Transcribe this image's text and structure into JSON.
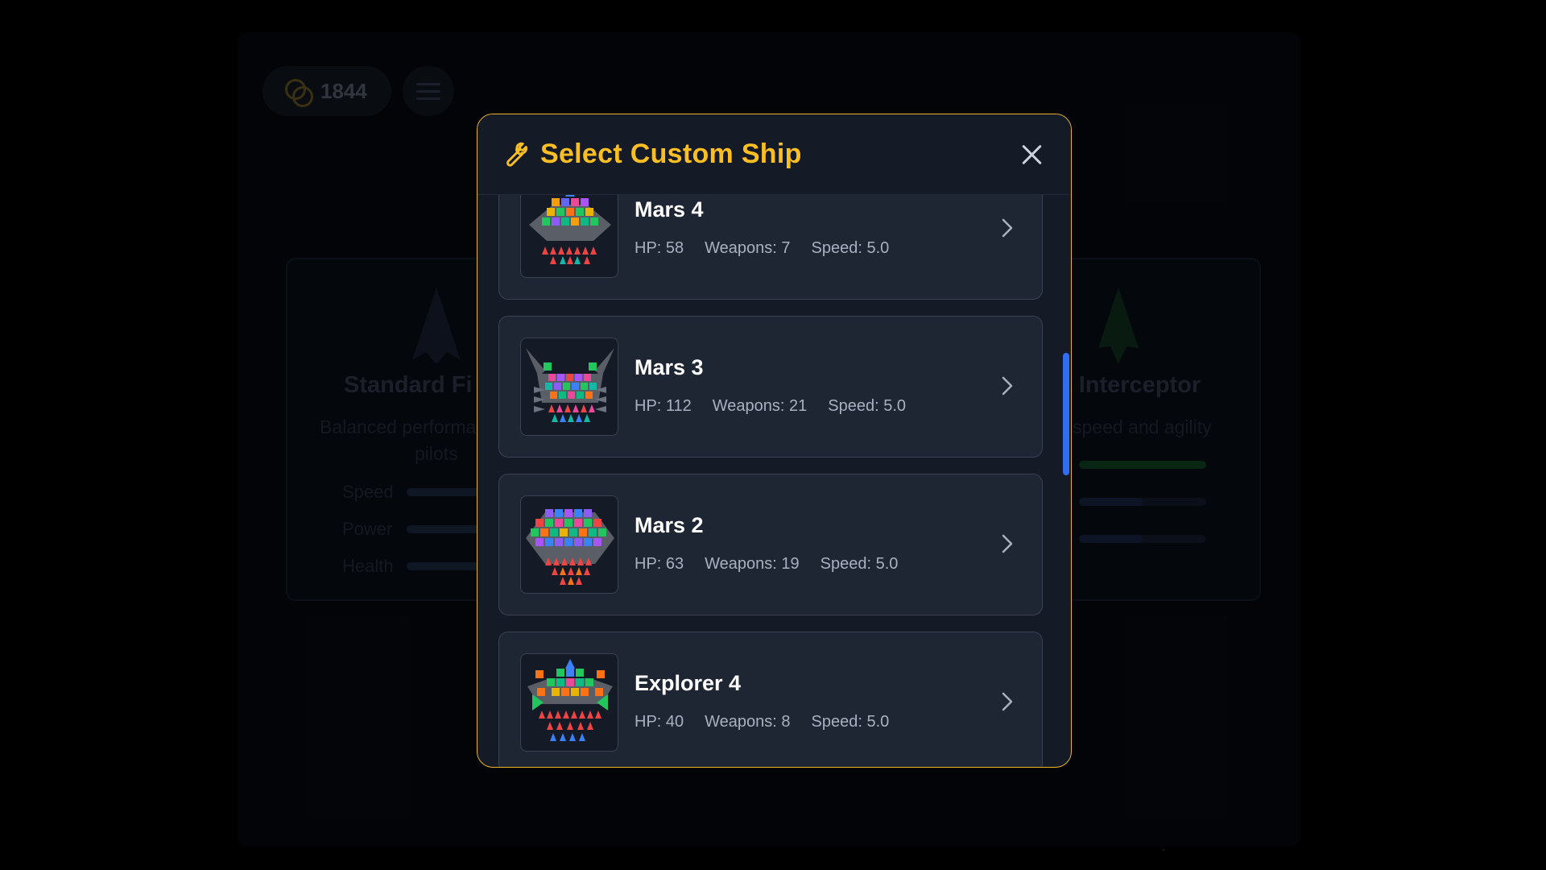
{
  "hud": {
    "coins": "1844"
  },
  "background_cards": [
    {
      "title": "Standard Fi",
      "subtitle_line1": "Balanced performa",
      "subtitle_line2": "pilots",
      "stats": [
        "Speed",
        "Power",
        "Health"
      ]
    },
    {
      "title": "t Interceptor",
      "subtitle_line1": "speed and agility"
    }
  ],
  "modal": {
    "title": "Select Custom Ship",
    "ships": [
      {
        "name": "Mars 4",
        "hp": "HP: 58",
        "weapons": "Weapons: 7",
        "speed": "Speed: 5.0"
      },
      {
        "name": "Mars 3",
        "hp": "HP: 112",
        "weapons": "Weapons: 21",
        "speed": "Speed: 5.0"
      },
      {
        "name": "Mars 2",
        "hp": "HP: 63",
        "weapons": "Weapons: 19",
        "speed": "Speed: 5.0"
      },
      {
        "name": "Explorer 4",
        "hp": "HP: 40",
        "weapons": "Weapons: 8",
        "speed": "Speed: 5.0"
      }
    ]
  },
  "colors": {
    "accent": "#fbbf24",
    "modal_border": "#f0b429",
    "scrollbar": "#2f6df3",
    "card_bg": "#1e2533"
  },
  "icons": {
    "title_icon": "wrench-icon",
    "close": "close-icon",
    "row_action": "chevron-right-icon",
    "coin": "coins-icon",
    "menu": "hamburger-icon"
  }
}
